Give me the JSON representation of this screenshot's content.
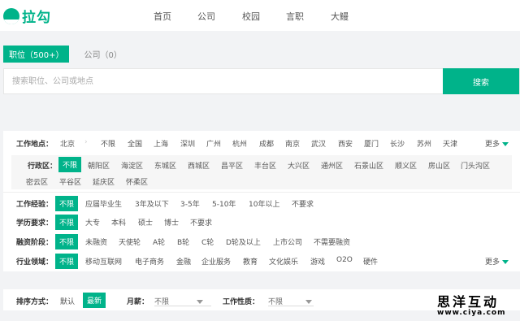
{
  "header": {
    "logo_text": "拉勾",
    "nav": [
      "首页",
      "公司",
      "校园",
      "言职",
      "大鳗"
    ]
  },
  "tabs": {
    "jobs": "职位（500+）",
    "companies": "公司（0）"
  },
  "search": {
    "placeholder": "搜索职位、公司或地点",
    "button": "搜索"
  },
  "filters": {
    "location": {
      "label": "工作地点：",
      "current": "北京",
      "options": [
        "不限",
        "全国",
        "上海",
        "深圳",
        "广州",
        "杭州",
        "成都",
        "南京",
        "武汉",
        "西安",
        "厦门",
        "长沙",
        "苏州",
        "天津"
      ],
      "selected": "不限",
      "more": "更多"
    },
    "district": {
      "label": "行政区：",
      "options": [
        "不限",
        "朝阳区",
        "海淀区",
        "东城区",
        "西城区",
        "昌平区",
        "丰台区",
        "大兴区",
        "通州区",
        "石景山区",
        "顺义区",
        "房山区",
        "门头沟区",
        "密云区",
        "平谷区",
        "延庆区",
        "怀柔区"
      ],
      "selected": "不限"
    },
    "experience": {
      "label": "工作经验：",
      "options": [
        "不限",
        "应届毕业生",
        "3年及以下",
        "3-5年",
        "5-10年",
        "10年以上",
        "不要求"
      ],
      "selected": "不限"
    },
    "education": {
      "label": "学历要求：",
      "options": [
        "不限",
        "大专",
        "本科",
        "硕士",
        "博士",
        "不要求"
      ],
      "selected": "不限"
    },
    "financing": {
      "label": "融资阶段：",
      "options": [
        "不限",
        "未融资",
        "天使轮",
        "A轮",
        "B轮",
        "C轮",
        "D轮及以上",
        "上市公司",
        "不需要融资"
      ],
      "selected": "不限"
    },
    "industry": {
      "label": "行业领域：",
      "options": [
        "不限",
        "移动互联网",
        "电子商务",
        "金融",
        "企业服务",
        "教育",
        "文化娱乐",
        "游戏",
        "O2O",
        "硬件"
      ],
      "selected": "不限",
      "more": "更多"
    }
  },
  "sort": {
    "label": "排序方式：",
    "options": [
      "默认",
      "最新"
    ],
    "selected": "最新",
    "salary_label": "月薪：",
    "salary_value": "不限",
    "nature_label": "工作性质：",
    "nature_value": "不限"
  },
  "watermark": {
    "title": "思洋互动",
    "url": "www.ciya.com"
  },
  "colors": {
    "accent": "#00b38a",
    "background": "#f2f3f5"
  }
}
